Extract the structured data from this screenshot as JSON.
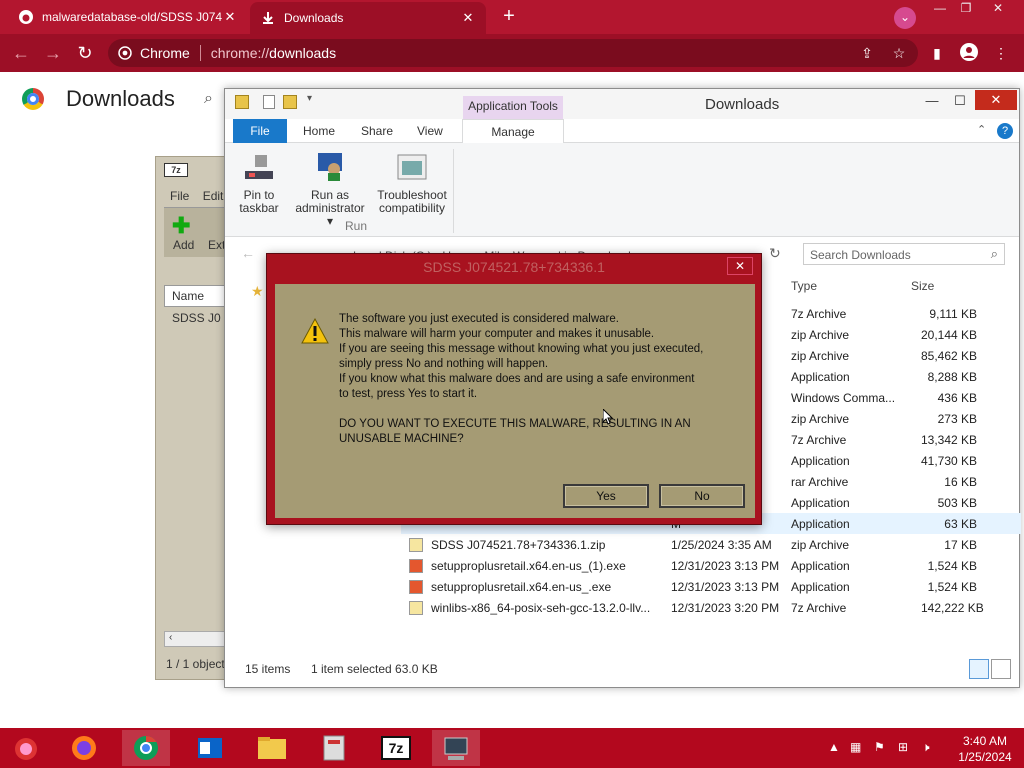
{
  "browser": {
    "tabs": [
      {
        "title": "malwaredatabase-old/SDSS J074",
        "icon": "github-icon"
      },
      {
        "title": "Downloads",
        "icon": "download-icon"
      }
    ],
    "omnibox": {
      "chip": "Chrome",
      "url_scheme": "chrome://",
      "url_path": "downloads"
    }
  },
  "downloads_page": {
    "title": "Downloads"
  },
  "sevenzip": {
    "menu_file": "File",
    "menu_edit": "Edit",
    "add": "Add",
    "extract": "Ext",
    "col_name": "Name",
    "item": "SDSS J0",
    "status": "1 / 1 object"
  },
  "explorer": {
    "app_tools": "Application Tools",
    "title": "Downloads",
    "tabs": [
      "File",
      "Home",
      "Share",
      "View",
      "Manage"
    ],
    "ribbon": {
      "pin": [
        "Pin to",
        "taskbar"
      ],
      "runas": [
        "Run as",
        "administrator ▾"
      ],
      "troubleshoot": [
        "Troubleshoot",
        "compatibility"
      ],
      "group": "Run"
    },
    "breadcrumb": "Local Disk (C:)  ›  Users  ›  Mike Wozowski  ›  Downloads",
    "search_placeholder": "Search Downloads",
    "columns": {
      "type": "Type",
      "size": "Size"
    },
    "rows": [
      {
        "date": "M",
        "type": "7z Archive",
        "size": "9,111 KB"
      },
      {
        "date": "M",
        "type": "zip Archive",
        "size": "20,144 KB"
      },
      {
        "date": "M",
        "type": "zip Archive",
        "size": "85,462 KB"
      },
      {
        "date": "M",
        "type": "Application",
        "size": "8,288 KB"
      },
      {
        "date": "M",
        "type": "Windows Comma...",
        "size": "436 KB"
      },
      {
        "date": "M",
        "type": "zip Archive",
        "size": "273 KB"
      },
      {
        "date": "M",
        "type": "7z Archive",
        "size": "13,342 KB"
      },
      {
        "date": "M",
        "type": "Application",
        "size": "41,730 KB"
      },
      {
        "date": "M",
        "type": "rar Archive",
        "size": "16 KB"
      },
      {
        "date": "M",
        "type": "Application",
        "size": "503 KB"
      },
      {
        "date": "M",
        "type": "Application",
        "size": "63 KB"
      }
    ],
    "files": [
      {
        "name": "SDSS J074521.78+734336.1.zip",
        "date": "1/25/2024 3:35 AM",
        "type": "zip Archive",
        "size": "17 KB"
      },
      {
        "name": "setupproplusretail.x64.en-us_(1).exe",
        "date": "12/31/2023 3:13 PM",
        "type": "Application",
        "size": "1,524 KB"
      },
      {
        "name": "setupproplusretail.x64.en-us_.exe",
        "date": "12/31/2023 3:13 PM",
        "type": "Application",
        "size": "1,524 KB"
      },
      {
        "name": "winlibs-x86_64-posix-seh-gcc-13.2.0-llv...",
        "date": "12/31/2023 3:20 PM",
        "type": "7z Archive",
        "size": "142,222 KB"
      }
    ],
    "status_count": "15 items",
    "status_selected": "1 item selected  63.0 KB"
  },
  "dialog": {
    "title": "SDSS J074521.78+734336.1",
    "lines": [
      "The software you just executed is considered malware.",
      "This malware will harm your computer and makes it unusable.",
      "If you are seeing this message without knowing what you just executed,",
      "simply press No and nothing will happen.",
      "If you know what this malware does and are using a safe environment",
      "to test, press Yes to start it."
    ],
    "question": [
      "DO YOU WANT TO EXECUTE THIS MALWARE, RESULTING IN AN",
      "UNUSABLE MACHINE?"
    ],
    "yes": "Yes",
    "no": "No"
  },
  "taskbar": {
    "time": "3:40 AM",
    "date": "1/25/2024"
  }
}
